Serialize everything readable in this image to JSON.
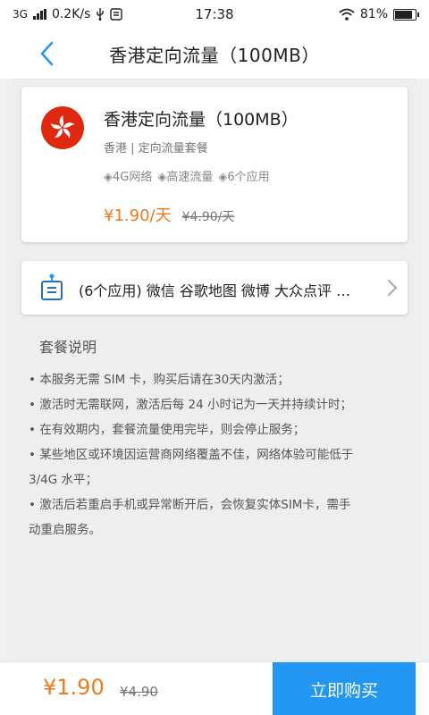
{
  "status_bar": {
    "network_type": "3G",
    "speed": "0.2K/s",
    "time": "17:38",
    "battery": "81%"
  },
  "nav": {
    "title": "香港定向流量（100MB）"
  },
  "product": {
    "title": "香港定向流量（100MB）",
    "subtitle": "香港 | 定向流量套餐",
    "features": [
      "◈4G网络",
      "◈高速流量",
      "◈6个应用"
    ],
    "price": "¥1.90/天",
    "old_price": "¥4.90/天"
  },
  "apps": {
    "label": "(6个应用) 微信 谷歌地图 微博 大众点评 …"
  },
  "description": {
    "title": "套餐说明",
    "items": [
      "• 本服务无需 SIM 卡，购买后请在30天内激活；",
      "• 激活时无需联网，激活后每 24 小时记为一天并持续计时；",
      "• 在有效期内，套餐流量使用完毕，则会停止服务；",
      "• 某些地区或环境因运营商网络覆盖不佳，网络体验可能低于",
      "3/4G 水平；",
      "• 激活后若重启手机或异常断开后，会恢复实体SIM卡，需手",
      "动重启服务。"
    ]
  },
  "bottom": {
    "price": "¥1.90",
    "old_price": "¥4.90",
    "buy_label": "立即购买"
  },
  "colors": {
    "accent": "#2196f3",
    "price": "#f07a1e",
    "flag": "#de2910"
  }
}
